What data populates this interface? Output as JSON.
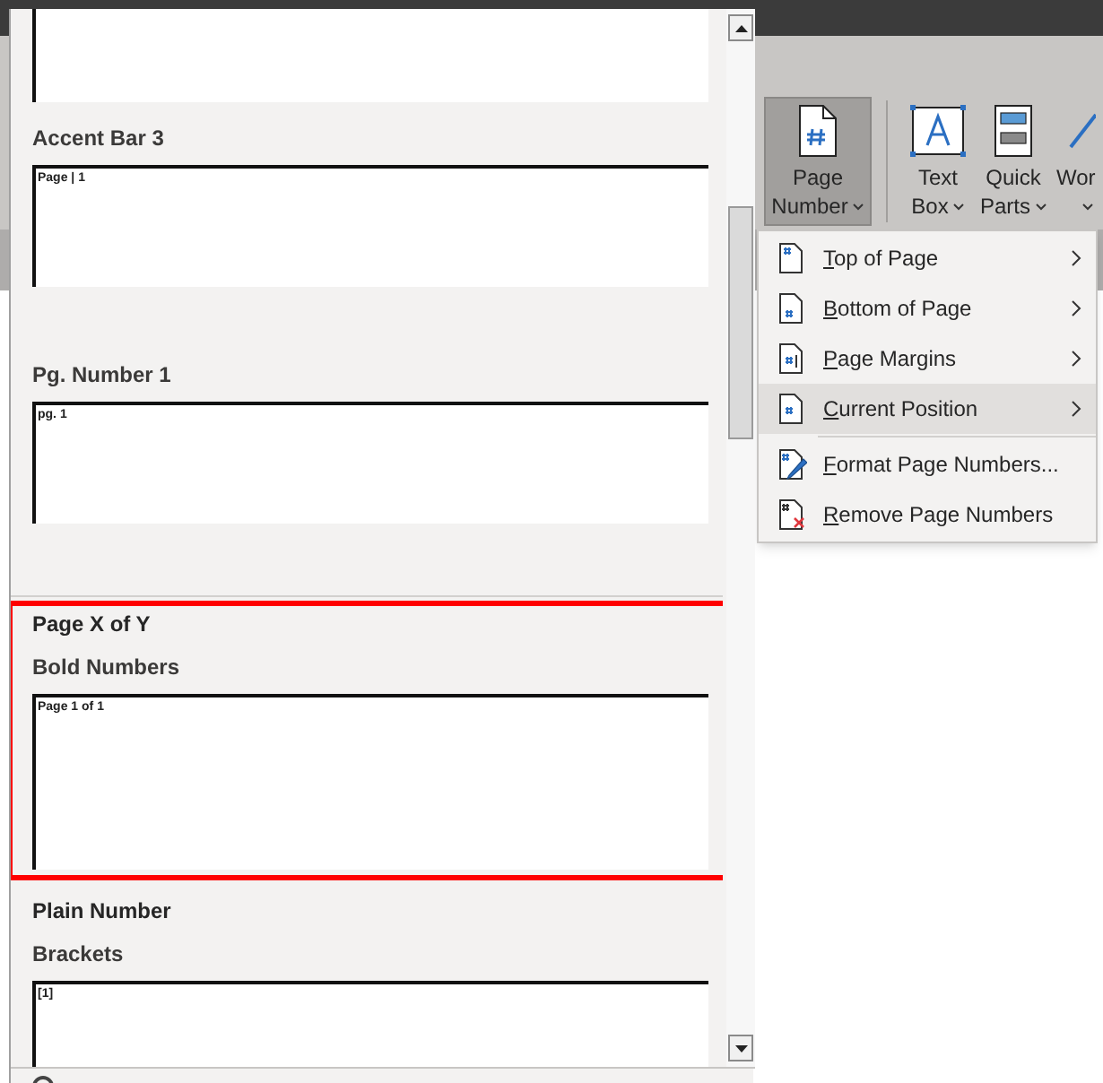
{
  "ribbon": {
    "buttons": [
      {
        "kind": "page-number",
        "lines": [
          "Page",
          "Number"
        ],
        "dropdown": true,
        "selected": true
      },
      {
        "kind": "text-box",
        "lines": [
          "Text",
          "Box"
        ],
        "dropdown": true,
        "selected": false
      },
      {
        "kind": "quick-parts",
        "lines": [
          "Quick",
          "Parts"
        ],
        "dropdown": true,
        "selected": false
      },
      {
        "kind": "wordart",
        "lines": [
          "Wor"
        ],
        "dropdown": true,
        "selected": false
      }
    ]
  },
  "menu": {
    "items": [
      {
        "kind": "item",
        "label": "Top of Page",
        "mnemonic_first": true,
        "submenu": true,
        "selected": false
      },
      {
        "kind": "item",
        "label": "Bottom of Page",
        "mnemonic_first": true,
        "submenu": true,
        "selected": false
      },
      {
        "kind": "item",
        "label": "Page Margins",
        "mnemonic_first": true,
        "submenu": true,
        "selected": false
      },
      {
        "kind": "item",
        "label": "Current Position",
        "mnemonic_first": true,
        "submenu": true,
        "selected": true
      },
      {
        "kind": "separator"
      },
      {
        "kind": "item",
        "label": "Format Page Numbers...",
        "mnemonic_first": true,
        "submenu": false,
        "selected": false
      },
      {
        "kind": "item",
        "label": "Remove Page Numbers",
        "mnemonic_first": true,
        "submenu": false,
        "selected": false
      }
    ]
  },
  "gallery": {
    "groups": [
      {
        "outlined": false,
        "items": [
          {
            "kind": "partial"
          },
          {
            "kind": "item",
            "title": "Accent Bar 3",
            "preview": "Page | 1"
          },
          {
            "kind": "item",
            "title": "Pg. Number 1",
            "preview": "pg. 1"
          }
        ]
      },
      {
        "title": "Page X of Y",
        "outlined": true,
        "items": [
          {
            "kind": "item",
            "title": "Bold Numbers",
            "preview": "Page 1 of 1"
          }
        ]
      },
      {
        "title": "Plain Number",
        "outlined": false,
        "items": [
          {
            "kind": "item",
            "title": "Brackets",
            "preview": "[1]"
          }
        ]
      }
    ]
  }
}
